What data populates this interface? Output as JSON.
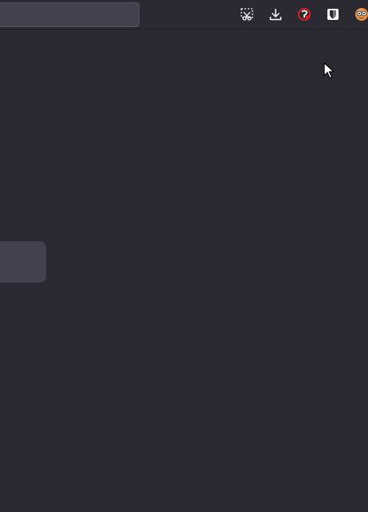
{
  "toolbar": {
    "urlbar_value": "",
    "buttons": [
      {
        "icon": "screenshot-icon"
      },
      {
        "icon": "download-icon"
      },
      {
        "icon": "extension-red-icon"
      },
      {
        "icon": "bitwarden-shield-icon"
      },
      {
        "icon": "extension-avatar-icon"
      }
    ]
  },
  "colors": {
    "background": "#2b2a33",
    "urlbar": "#42414d",
    "card": "#42414d",
    "icon": "#fbfbfe"
  }
}
